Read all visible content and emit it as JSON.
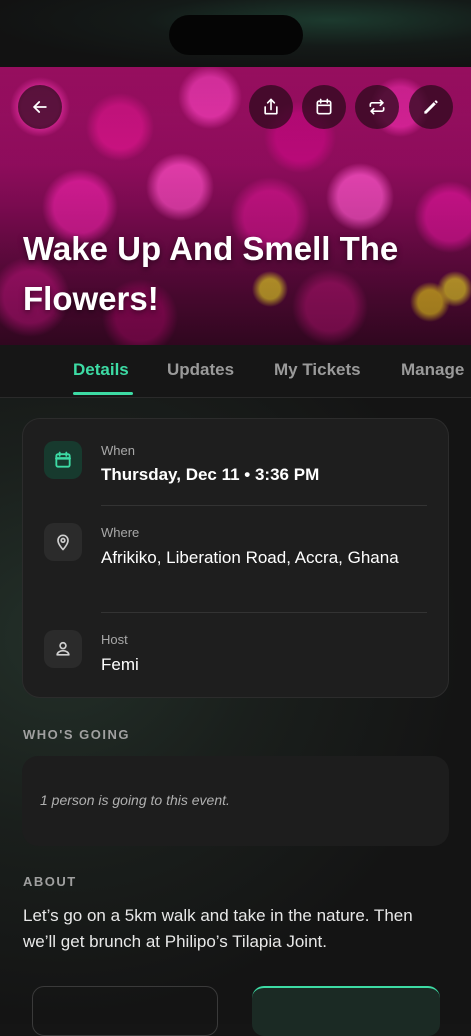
{
  "event": {
    "title": "Wake Up And Smell The Flowers!"
  },
  "header": {
    "actions": [
      {
        "icon": "arrow-left-icon"
      },
      {
        "icon": "share-icon"
      },
      {
        "icon": "calendar-icon"
      },
      {
        "icon": "repeat-icon"
      },
      {
        "icon": "pencil-icon"
      }
    ]
  },
  "tabs": [
    {
      "label": "Details",
      "active": true
    },
    {
      "label": "Updates",
      "active": false
    },
    {
      "label": "My Tickets",
      "active": false
    },
    {
      "label": "Manage",
      "active": false
    }
  ],
  "details": {
    "when": {
      "label": "When",
      "value": "Thursday, Dec 11 • 3:36 PM",
      "icon": "calendar-icon"
    },
    "where": {
      "label": "Where",
      "value": "Afrikiko, Liberation Road, Accra, Ghana",
      "icon": "map-pin-icon"
    },
    "host": {
      "label": "Host",
      "value": "Femi",
      "icon": "person-icon"
    }
  },
  "whos_going": {
    "heading": "WHO'S GOING",
    "text": "1 person is going to this event."
  },
  "about": {
    "heading": "ABOUT",
    "text": "Let’s go on a 5km walk and take in the nature. Then we’ll get brunch at Philipo’s Tilapia Joint."
  },
  "colors": {
    "accent": "#3ddba4",
    "background": "#151515",
    "card": "#1e1e1e"
  }
}
